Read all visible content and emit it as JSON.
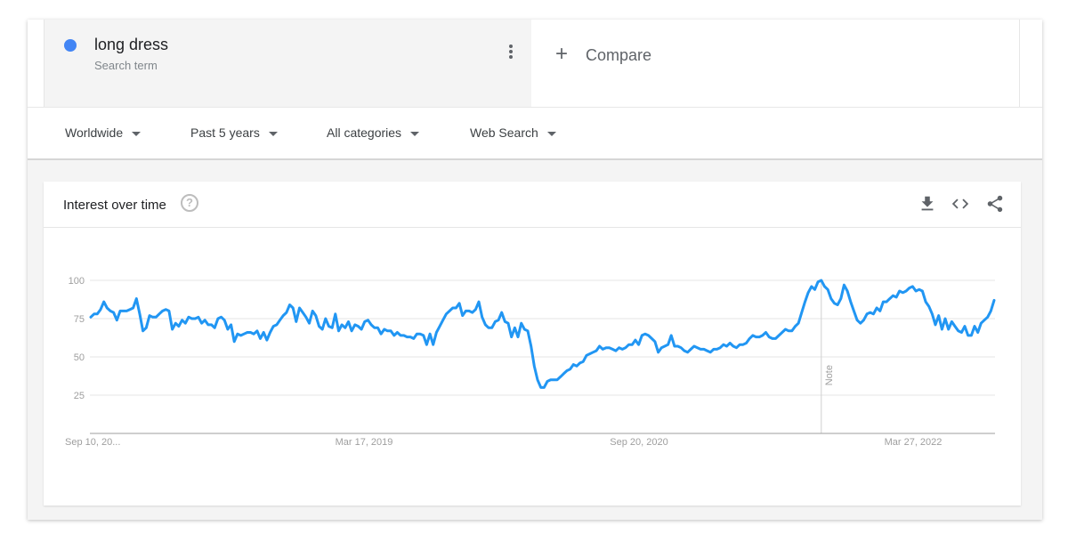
{
  "search_term": {
    "name": "long dress",
    "subtitle": "Search term",
    "color": "#4285f4"
  },
  "compare": {
    "icon": "+",
    "label": "Compare"
  },
  "filters": [
    {
      "label": "Worldwide"
    },
    {
      "label": "Past 5 years"
    },
    {
      "label": "All categories"
    },
    {
      "label": "Web Search"
    }
  ],
  "card": {
    "title": "Interest over time",
    "help_icon": "?",
    "actions": [
      "download-icon",
      "embed-code-icon",
      "share-icon"
    ]
  },
  "chart_data": {
    "type": "line",
    "title": "Interest over time",
    "xlabel": "",
    "ylabel": "",
    "ylim": [
      0,
      100
    ],
    "yticks": [
      25,
      50,
      75,
      100
    ],
    "grid": true,
    "legend": "none",
    "x_tick_labels": [
      "Sep 10, 20...",
      "Mar 17, 2019",
      "Sep 20, 2020",
      "Mar 27, 2022"
    ],
    "x_tick_positions": [
      0,
      79,
      158,
      237
    ],
    "annotations": [
      {
        "label": "Note",
        "x_index": 224
      }
    ],
    "series": [
      {
        "name": "long dress",
        "color": "#2196f3",
        "values": [
          76,
          78,
          78,
          81,
          86,
          82,
          80,
          79,
          74,
          80,
          80,
          80,
          81,
          82,
          88,
          78,
          67,
          69,
          77,
          76,
          76,
          78,
          80,
          81,
          80,
          68,
          72,
          70,
          74,
          72,
          76,
          75,
          75,
          76,
          72,
          74,
          71,
          71,
          69,
          75,
          76,
          74,
          68,
          71,
          60,
          65,
          64,
          65,
          66,
          66,
          65,
          67,
          62,
          66,
          61,
          66,
          70,
          71,
          74,
          77,
          79,
          84,
          82,
          73,
          82,
          79,
          76,
          72,
          80,
          77,
          70,
          68,
          75,
          70,
          69,
          78,
          67,
          71,
          69,
          73,
          67,
          71,
          70,
          68,
          73,
          74,
          71,
          69,
          69,
          65,
          68,
          67,
          67,
          64,
          66,
          64,
          64,
          63,
          63,
          62,
          65,
          65,
          64,
          58,
          65,
          58,
          66,
          70,
          74,
          78,
          80,
          82,
          82,
          85,
          77,
          80,
          80,
          79,
          81,
          86,
          76,
          71,
          69,
          69,
          73,
          74,
          79,
          73,
          72,
          63,
          69,
          63,
          72,
          68,
          67,
          57,
          44,
          35,
          30,
          30,
          34,
          35,
          35,
          35,
          37,
          39,
          41,
          42,
          45,
          44,
          46,
          47,
          51,
          52,
          53,
          54,
          57,
          55,
          56,
          56,
          55,
          54,
          56,
          55,
          56,
          58,
          58,
          61,
          58,
          64,
          65,
          64,
          62,
          60,
          53,
          56,
          57,
          58,
          64,
          57,
          57,
          56,
          54,
          53,
          55,
          57,
          56,
          55,
          55,
          54,
          53,
          55,
          55,
          56,
          58,
          57,
          59,
          57,
          56,
          58,
          58,
          59,
          62,
          64,
          63,
          63,
          64,
          66,
          63,
          62,
          62,
          64,
          66,
          68,
          67,
          67,
          70,
          72,
          79,
          86,
          92,
          96,
          94,
          99,
          100,
          96,
          94,
          88,
          85,
          84,
          88,
          97,
          93,
          86,
          80,
          74,
          72,
          74,
          78,
          79,
          78,
          82,
          80,
          86,
          86,
          88,
          90,
          89,
          93,
          92,
          93,
          95,
          96,
          93,
          94,
          93,
          86,
          83,
          78,
          71,
          77,
          68,
          75,
          68,
          73,
          70,
          67,
          66,
          70,
          64,
          64,
          70,
          66,
          72,
          74,
          76,
          80,
          87
        ]
      }
    ]
  }
}
